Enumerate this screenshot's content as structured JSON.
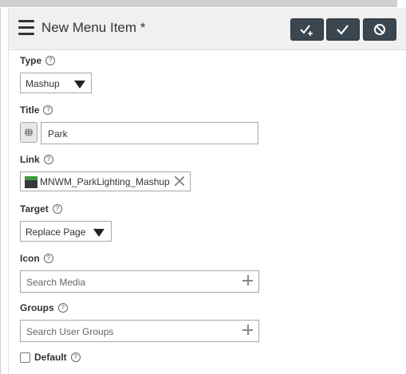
{
  "header": {
    "title": "New Menu Item *",
    "buttons": {
      "save_and_new": "check-plus-icon",
      "save": "check-icon",
      "cancel": "cancel-icon"
    },
    "colors": {
      "button_bg": "#3a4650",
      "header_bg": "#f0f0f0"
    }
  },
  "form": {
    "type": {
      "label": "Type",
      "value": "Mashup"
    },
    "title": {
      "label": "Title",
      "value": "Park"
    },
    "link": {
      "label": "Link",
      "value": "MNWM_ParkLighting_Mashup"
    },
    "target": {
      "label": "Target",
      "value": "Replace Page"
    },
    "icon": {
      "label": "Icon",
      "placeholder": "Search Media"
    },
    "groups": {
      "label": "Groups",
      "placeholder": "Search User Groups"
    },
    "default": {
      "label": "Default",
      "checked": false
    }
  },
  "help_glyph": "?"
}
